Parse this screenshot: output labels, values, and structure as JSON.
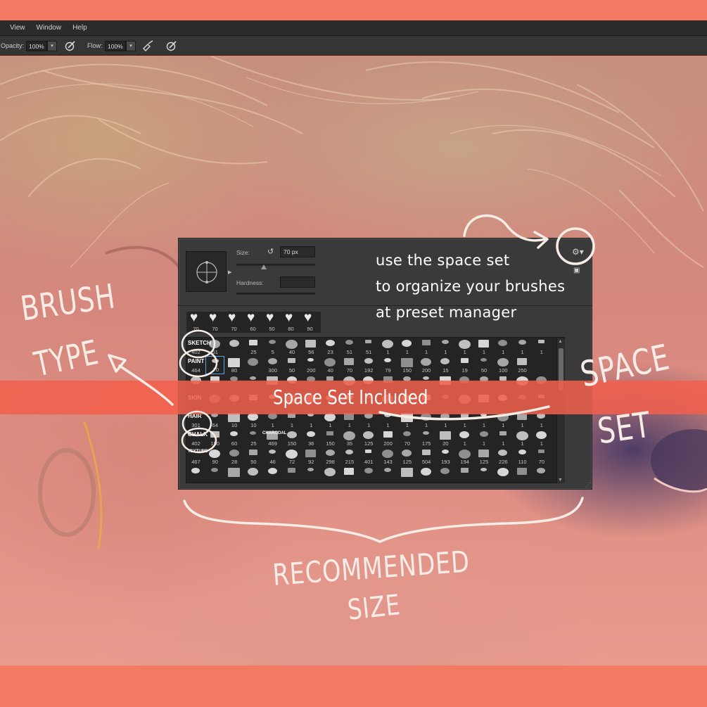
{
  "menubar": {
    "items": [
      "View",
      "Window",
      "Help"
    ]
  },
  "options_bar": {
    "opacity_label": "Opacity:",
    "opacity_value": "100%",
    "flow_label": "Flow:",
    "flow_value": "100%"
  },
  "brush_panel": {
    "size_label": "Size:",
    "size_value": "70 px",
    "hardness_label": "Hardness:",
    "hardness_value": "",
    "heart_sizes": [
      "70",
      "70",
      "70",
      "60",
      "50",
      "80",
      "90"
    ],
    "rows": [
      {
        "label": "SKETCH",
        "sizes": [
          "402",
          "51",
          "",
          "25",
          "5",
          "40",
          "56",
          "23",
          "51",
          "51",
          "1",
          "1",
          "1",
          "1",
          "1",
          "1",
          "1",
          "1",
          "1"
        ]
      },
      {
        "label": "PAINT",
        "sizes": [
          "464",
          "70",
          "80",
          "",
          "300",
          "50",
          "200",
          "40",
          "70",
          "192",
          "79",
          "150",
          "200",
          "15",
          "19",
          "50",
          "100",
          "250"
        ]
      },
      {
        "label": "",
        "sizes": [
          "",
          "",
          "",
          "",
          "",
          "",
          "",
          "",
          "",
          "",
          "",
          "",
          "",
          "",
          "",
          "",
          "",
          "",
          ""
        ]
      },
      {
        "label": "SKIN",
        "sizes": [
          "",
          "",
          "",
          "",
          "",
          "",
          "",
          "",
          "",
          "",
          "",
          "",
          "",
          "",
          "",
          "",
          "",
          "",
          ""
        ]
      },
      {
        "label": "HAIR",
        "sizes": [
          "301",
          "64",
          "10",
          "10",
          "1",
          "1",
          "1",
          "1",
          "1",
          "1",
          "1",
          "1",
          "1",
          "1",
          "1",
          "1",
          "1",
          "1",
          "1"
        ]
      },
      {
        "label": "CHALK",
        "sizes": [
          "402",
          "150",
          "60",
          "25",
          "469",
          "150",
          "36",
          "150",
          "35",
          "125",
          "200",
          "70",
          "175",
          "20",
          "1",
          "1",
          "1",
          "1",
          "1"
        ]
      },
      {
        "label": "TEXTURE",
        "sizes": [
          "467",
          "90",
          "28",
          "50",
          "46",
          "72",
          "92",
          "298",
          "215",
          "401",
          "143",
          "125",
          "504",
          "193",
          "194",
          "125",
          "226",
          "110",
          "70"
        ]
      },
      {
        "label": "",
        "sizes": [
          "",
          "",
          "",
          "",
          "",
          "",
          "",
          "",
          "",
          "",
          "",
          "",
          "",
          "",
          "",
          "",
          "",
          "",
          ""
        ]
      }
    ],
    "charcoal_label": "CHARCOAL"
  },
  "tip": {
    "line1": "use the space set",
    "line2": "to organize your brushes",
    "line3": "at preset manager"
  },
  "banner": {
    "text": "Space Set Included"
  },
  "annotations": {
    "brush": "BRUSH",
    "type": "TYPE",
    "space": "SPACE",
    "set": "SET",
    "recommended": "RECOMMENDED",
    "size": "SIZE"
  },
  "colors": {
    "accent": "#f47a63",
    "panel": "#3a3a3a",
    "banner": "#f2604c"
  }
}
